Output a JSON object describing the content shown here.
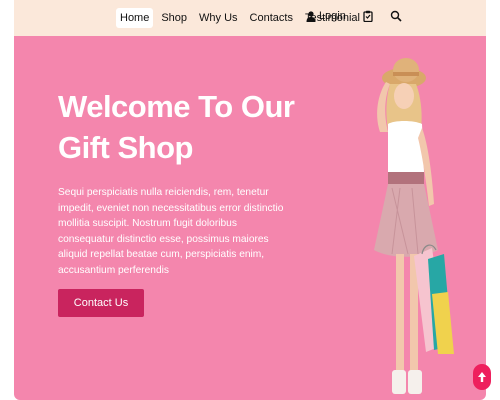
{
  "nav": {
    "links": [
      "Home",
      "Shop",
      "Why Us",
      "Contacts",
      "Testimonial"
    ],
    "login_label": "Login"
  },
  "hero": {
    "title": "Welcome To Our Gift Shop",
    "text": "Sequi perspiciatis nulla reiciendis, rem, tenetur impedit, eveniet non necessitatibus error distinctio mollitia suscipit. Nostrum fugit doloribus consequatur distinctio esse, possimus maiores aliquid repellat beatae cum, perspiciatis enim, accusantium perferendis",
    "cta_label": "Contact Us"
  },
  "colors": {
    "hero_bg": "#f486ad",
    "nav_bg": "#fbe8da",
    "cta_bg": "#c9245e",
    "scroll_top_bg": "#ee1f5d"
  },
  "icons": [
    "user-icon",
    "clipboard-icon",
    "search-icon",
    "arrow-up-icon"
  ]
}
